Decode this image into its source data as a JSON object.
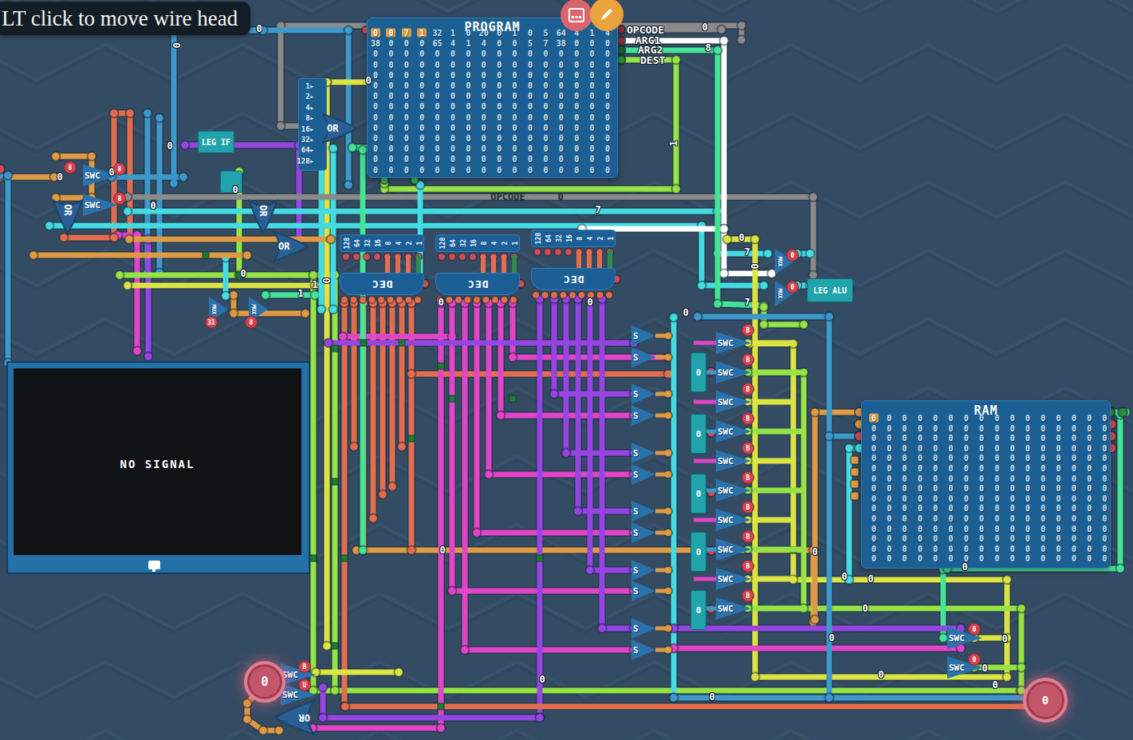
{
  "tooltip": {
    "text": "LT click to move wire head"
  },
  "program": {
    "title": "PROGRAM",
    "highlight_cols": 4,
    "rows": [
      [
        "0",
        "0",
        "7",
        "1",
        "32",
        "1",
        "0",
        "20",
        "0",
        "1",
        "0",
        "5",
        "64",
        "4",
        "1",
        "4"
      ],
      [
        "38",
        "0",
        "0",
        "0",
        "65",
        "4",
        "1",
        "4",
        "0",
        "0",
        "5",
        "7",
        "38",
        "0",
        "0",
        "0"
      ],
      [
        "0",
        "0",
        "0",
        "0",
        "0",
        "0",
        "0",
        "0",
        "0",
        "0",
        "0",
        "0",
        "0",
        "0",
        "0",
        "0"
      ],
      [
        "0",
        "0",
        "0",
        "0",
        "0",
        "0",
        "0",
        "0",
        "0",
        "0",
        "0",
        "0",
        "0",
        "0",
        "0",
        "0"
      ],
      [
        "0",
        "0",
        "0",
        "0",
        "0",
        "0",
        "0",
        "0",
        "0",
        "0",
        "0",
        "0",
        "0",
        "0",
        "0",
        "0"
      ],
      [
        "0",
        "0",
        "0",
        "0",
        "0",
        "0",
        "0",
        "0",
        "0",
        "0",
        "0",
        "0",
        "0",
        "0",
        "0",
        "0"
      ],
      [
        "0",
        "0",
        "0",
        "0",
        "0",
        "0",
        "0",
        "0",
        "0",
        "0",
        "0",
        "0",
        "0",
        "0",
        "0",
        "0"
      ],
      [
        "0",
        "0",
        "0",
        "0",
        "0",
        "0",
        "0",
        "0",
        "0",
        "0",
        "0",
        "0",
        "0",
        "0",
        "0",
        "0"
      ],
      [
        "0",
        "0",
        "0",
        "0",
        "0",
        "0",
        "0",
        "0",
        "0",
        "0",
        "0",
        "0",
        "0",
        "0",
        "0",
        "0"
      ],
      [
        "0",
        "0",
        "0",
        "0",
        "0",
        "0",
        "0",
        "0",
        "0",
        "0",
        "0",
        "0",
        "0",
        "0",
        "0",
        "0"
      ],
      [
        "0",
        "0",
        "0",
        "0",
        "0",
        "0",
        "0",
        "0",
        "0",
        "0",
        "0",
        "0",
        "0",
        "0",
        "0",
        "0"
      ],
      [
        "0",
        "0",
        "0",
        "0",
        "0",
        "0",
        "0",
        "0",
        "0",
        "0",
        "0",
        "0",
        "0",
        "0",
        "0",
        "0"
      ],
      [
        "0",
        "0",
        "0",
        "0",
        "0",
        "0",
        "0",
        "0",
        "0",
        "0",
        "0",
        "0",
        "0",
        "0",
        "0",
        "0"
      ],
      [
        "0",
        "0",
        "0",
        "0",
        "0",
        "0",
        "0",
        "0",
        "0",
        "0",
        "0",
        "0",
        "0",
        "0",
        "0",
        "0"
      ]
    ]
  },
  "ram": {
    "title": "RAM",
    "rows": 15,
    "cols": 16,
    "fill": "0"
  },
  "screen": {
    "text": "NO SIGNAL"
  },
  "legend": {
    "items": [
      {
        "label": "OPCODE",
        "color": "#7a7a7a"
      },
      {
        "label": "ARG1",
        "color": "#ffffff"
      },
      {
        "label": "ARG2",
        "color": "#45e396"
      },
      {
        "label": "DEST",
        "color": "#96e345"
      }
    ]
  },
  "bit_labels": [
    "1",
    "2",
    "4",
    "8",
    "16",
    "32",
    "64",
    "128"
  ],
  "dec_bits": [
    "128",
    "64",
    "32",
    "16",
    "8",
    "4",
    "2",
    "1"
  ],
  "components": {
    "dec": "DEC",
    "swc": "SWC",
    "mux": "MUX",
    "or": "OR",
    "s": "S",
    "leg_if": "LEG IF",
    "leg_alu": "LEG ALU",
    "register_value": "0",
    "terminal_value": "0",
    "opcode_bus_label": "OPCODE"
  },
  "badges": {
    "swc_right": "B",
    "swc_left": "8",
    "swc_bottom": [
      "B",
      "U"
    ],
    "mux_left": [
      "31",
      "8"
    ],
    "mux_right": [
      "0",
      "0"
    ],
    "or_left": "8"
  },
  "wire_labels": [
    [
      325,
      36,
      "0"
    ],
    [
      222,
      57,
      "0",
      "r"
    ],
    [
      140,
      216,
      "0"
    ],
    [
      75,
      222,
      "0"
    ],
    [
      192,
      258,
      "0"
    ],
    [
      295,
      238,
      "0"
    ],
    [
      213,
      183,
      "0"
    ],
    [
      462,
      101,
      "0"
    ],
    [
      884,
      34,
      "0"
    ],
    [
      888,
      60,
      "8"
    ],
    [
      845,
      180,
      "1",
      "r"
    ],
    [
      637,
      247,
      "OPCODE",
      "d"
    ],
    [
      703,
      247,
      "0",
      "d"
    ],
    [
      750,
      263,
      "7"
    ],
    [
      937,
      316,
      "7"
    ],
    [
      937,
      379,
      "7"
    ],
    [
      930,
      298,
      "0"
    ],
    [
      947,
      334,
      "0",
      "r"
    ],
    [
      395,
      357,
      "1"
    ],
    [
      377,
      368,
      "1"
    ],
    [
      305,
      343,
      "0"
    ],
    [
      553,
      379,
      "0"
    ],
    [
      740,
      379,
      "0"
    ],
    [
      860,
      392,
      "0"
    ],
    [
      1210,
      711,
      "0"
    ],
    [
      1059,
      723,
      "0"
    ],
    [
      1092,
      726,
      "0"
    ],
    [
      1085,
      763,
      "0"
    ],
    [
      1043,
      800,
      "0"
    ],
    [
      1260,
      801,
      "0"
    ],
    [
      1235,
      838,
      "0"
    ],
    [
      893,
      874,
      "0"
    ],
    [
      1105,
      846,
      "0"
    ],
    [
      1248,
      859,
      "0"
    ],
    [
      680,
      852,
      "0"
    ],
    [
      555,
      690,
      "0"
    ],
    [
      410,
      352,
      "0",
      "r"
    ],
    [
      1022,
      692,
      "0"
    ]
  ]
}
